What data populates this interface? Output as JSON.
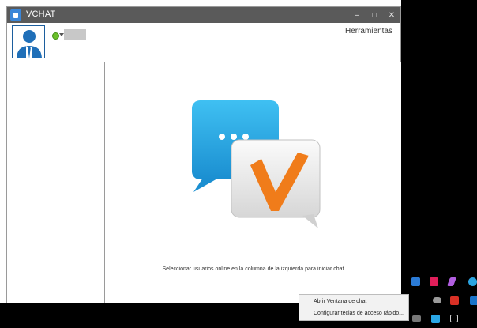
{
  "window": {
    "title": "VCHAT",
    "controls": {
      "minimize": "–",
      "maximize": "□",
      "close": "✕"
    }
  },
  "header": {
    "status_color": "#6bbf2a",
    "tools_label": "Herramientas"
  },
  "main": {
    "hint_text": "Seleccionar usuarios online en la columna de la izquierda para iniciar chat",
    "logo": {
      "bubble_color": "#2aa7e6",
      "check_color": "#f07c1a"
    }
  },
  "tray": {
    "icons": [
      "windows-security-icon",
      "slack-icon",
      "pen-icon",
      "telegram-icon",
      "cloud-icon",
      "record-icon",
      "outlook-icon",
      "display-icon",
      "vchat-tray-icon",
      "window-icon"
    ]
  },
  "context_menu": {
    "items": [
      {
        "label": "Abrir Ventana de chat"
      },
      {
        "label": "Configurar teclas de acceso rápido..."
      }
    ]
  }
}
